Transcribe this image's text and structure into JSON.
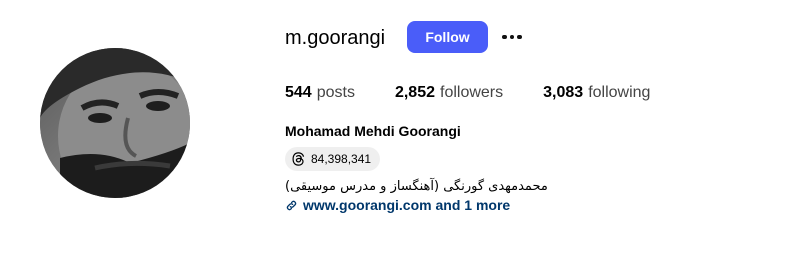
{
  "profile": {
    "username": "m.goorangi",
    "follow_label": "Follow",
    "more_icon": "more-horizontal-icon",
    "full_name": "Mohamad Mehdi Goorangi",
    "bio": "محمدمهدی گورنگی (آهنگساز و مدرس موسیقی)",
    "link_text": "www.goorangi.com and 1 more",
    "link_icon": "link-icon"
  },
  "stats": {
    "posts_count": "544",
    "posts_label": "posts",
    "followers_count": "2,852",
    "followers_label": "followers",
    "following_count": "3,083",
    "following_label": "following"
  },
  "threads": {
    "icon": "threads-icon",
    "count": "84,398,341"
  },
  "colors": {
    "follow_button": "#4a5df9",
    "link": "#00376b",
    "badge_bg": "#efefef"
  }
}
